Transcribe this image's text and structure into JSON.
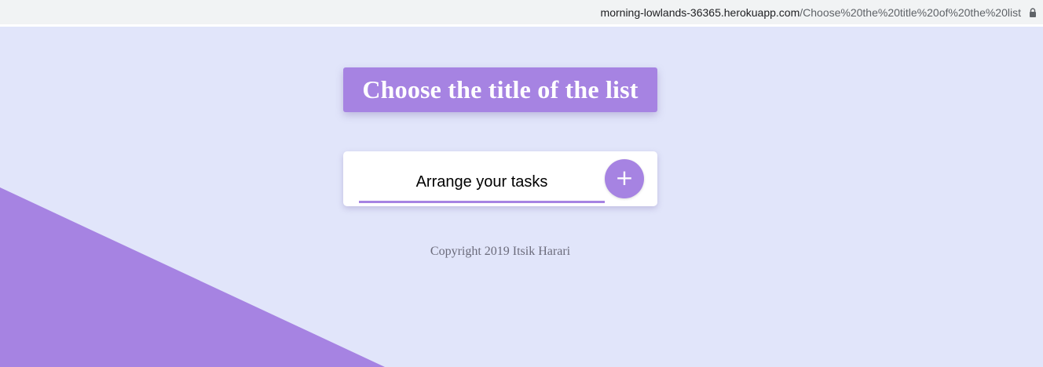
{
  "browser": {
    "url_host": "morning-lowlands-36365.herokuapp.com",
    "url_path": "/Choose%20the%20title%20of%20the%20list",
    "lock_icon": "lock-icon"
  },
  "header": {
    "title": "Choose the title of the list"
  },
  "form": {
    "input_value": "Arrange your tasks",
    "add_button_label": "+",
    "add_button_icon": "plus-icon"
  },
  "footer": {
    "copyright": "Copyright 2019 Itsik Harari"
  },
  "colors": {
    "accent": "#a683e2",
    "background": "#e1e5fa",
    "card": "#ffffff"
  }
}
